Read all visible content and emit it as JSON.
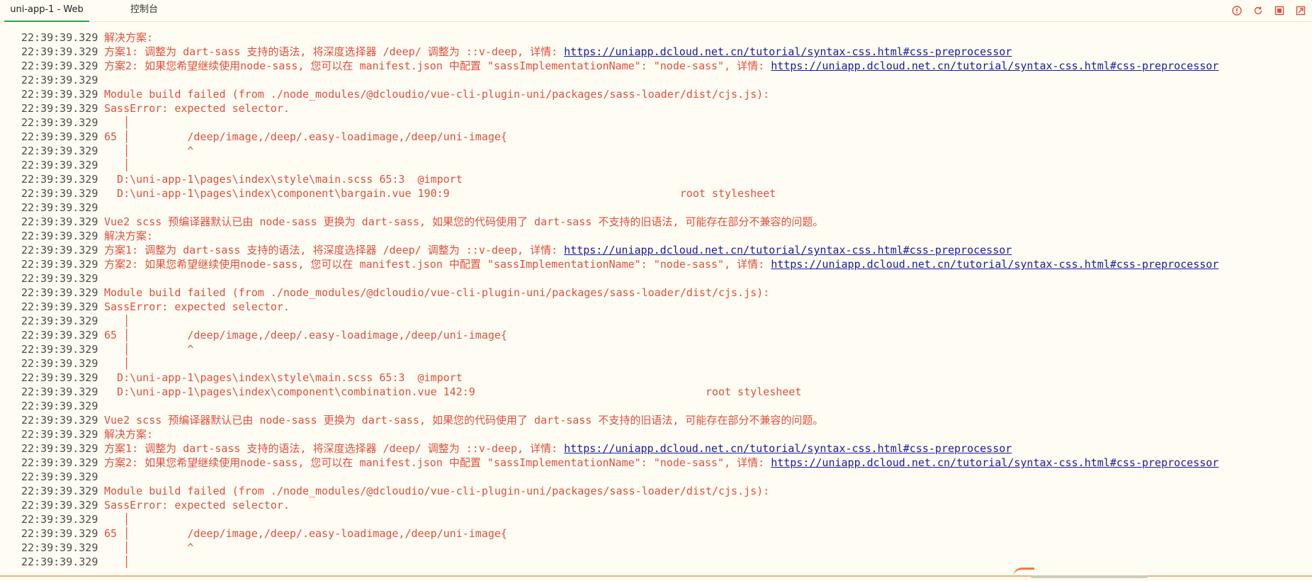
{
  "tabs": [
    {
      "label": "uni-app-1 - Web",
      "active": true
    },
    {
      "label": "控制台",
      "active": false
    }
  ],
  "toolbar_icons": [
    "warning-icon",
    "refresh-icon",
    "stop-icon",
    "clear-icon"
  ],
  "colors": {
    "background": "#fffdf3",
    "error": "#e0503f",
    "link": "#1a1aa6",
    "timestamp": "#4b4b4b",
    "active_tab": "#2ea44f"
  },
  "lines": [
    {
      "ts": "22:39:39.329",
      "text": "解决方案:"
    },
    {
      "ts": "22:39:39.329",
      "text": "方案1: 调整为 dart-sass 支持的语法, 将深度选择器 /deep/ 调整为 ::v-deep, 详情: ",
      "link": "https://uniapp.dcloud.net.cn/tutorial/syntax-css.html#css-preprocessor"
    },
    {
      "ts": "22:39:39.329",
      "text": "方案2: 如果您希望继续使用node-sass, 您可以在 manifest.json 中配置 \"sassImplementationName\": \"node-sass\", 详情: ",
      "link": "https://uniapp.dcloud.net.cn/tutorial/syntax-css.html#css-preprocessor"
    },
    {
      "ts": "22:39:39.329",
      "text": ""
    },
    {
      "ts": "22:39:39.329",
      "text": "Module build failed (from ./node_modules/@dcloudio/vue-cli-plugin-uni/packages/sass-loader/dist/cjs.js):"
    },
    {
      "ts": "22:39:39.329",
      "text": "SassError: expected selector."
    },
    {
      "ts": "22:39:39.329",
      "text": "   │"
    },
    {
      "ts": "22:39:39.329",
      "text": "65 │         /deep/image,/deep/.easy-loadimage,/deep/uni-image{"
    },
    {
      "ts": "22:39:39.329",
      "text": "   │         ^"
    },
    {
      "ts": "22:39:39.329",
      "text": "   │"
    },
    {
      "ts": "22:39:39.329",
      "text": "  D:\\uni-app-1\\pages\\index\\style\\main.scss 65:3  @import"
    },
    {
      "ts": "22:39:39.329",
      "text": "  D:\\uni-app-1\\pages\\index\\component\\bargain.vue 190:9                                    root stylesheet"
    },
    {
      "ts": "22:39:39.329",
      "text": ""
    },
    {
      "ts": "22:39:39.329",
      "text": "Vue2 scss 预编译器默认已由 node-sass 更换为 dart-sass, 如果您的代码使用了 dart-sass 不支持的旧语法, 可能存在部分不兼容的问题。"
    },
    {
      "ts": "22:39:39.329",
      "text": "解决方案:"
    },
    {
      "ts": "22:39:39.329",
      "text": "方案1: 调整为 dart-sass 支持的语法, 将深度选择器 /deep/ 调整为 ::v-deep, 详情: ",
      "link": "https://uniapp.dcloud.net.cn/tutorial/syntax-css.html#css-preprocessor"
    },
    {
      "ts": "22:39:39.329",
      "text": "方案2: 如果您希望继续使用node-sass, 您可以在 manifest.json 中配置 \"sassImplementationName\": \"node-sass\", 详情: ",
      "link": "https://uniapp.dcloud.net.cn/tutorial/syntax-css.html#css-preprocessor"
    },
    {
      "ts": "22:39:39.329",
      "text": ""
    },
    {
      "ts": "22:39:39.329",
      "text": "Module build failed (from ./node_modules/@dcloudio/vue-cli-plugin-uni/packages/sass-loader/dist/cjs.js):"
    },
    {
      "ts": "22:39:39.329",
      "text": "SassError: expected selector."
    },
    {
      "ts": "22:39:39.329",
      "text": "   │"
    },
    {
      "ts": "22:39:39.329",
      "text": "65 │         /deep/image,/deep/.easy-loadimage,/deep/uni-image{"
    },
    {
      "ts": "22:39:39.329",
      "text": "   │         ^"
    },
    {
      "ts": "22:39:39.329",
      "text": "   │"
    },
    {
      "ts": "22:39:39.329",
      "text": "  D:\\uni-app-1\\pages\\index\\style\\main.scss 65:3  @import"
    },
    {
      "ts": "22:39:39.329",
      "text": "  D:\\uni-app-1\\pages\\index\\component\\combination.vue 142:9                                    root stylesheet"
    },
    {
      "ts": "22:39:39.329",
      "text": ""
    },
    {
      "ts": "22:39:39.329",
      "text": "Vue2 scss 预编译器默认已由 node-sass 更换为 dart-sass, 如果您的代码使用了 dart-sass 不支持的旧语法, 可能存在部分不兼容的问题。"
    },
    {
      "ts": "22:39:39.329",
      "text": "解决方案:"
    },
    {
      "ts": "22:39:39.329",
      "text": "方案1: 调整为 dart-sass 支持的语法, 将深度选择器 /deep/ 调整为 ::v-deep, 详情: ",
      "link": "https://uniapp.dcloud.net.cn/tutorial/syntax-css.html#css-preprocessor"
    },
    {
      "ts": "22:39:39.329",
      "text": "方案2: 如果您希望继续使用node-sass, 您可以在 manifest.json 中配置 \"sassImplementationName\": \"node-sass\", 详情: ",
      "link": "https://uniapp.dcloud.net.cn/tutorial/syntax-css.html#css-preprocessor"
    },
    {
      "ts": "22:39:39.329",
      "text": ""
    },
    {
      "ts": "22:39:39.329",
      "text": "Module build failed (from ./node_modules/@dcloudio/vue-cli-plugin-uni/packages/sass-loader/dist/cjs.js):"
    },
    {
      "ts": "22:39:39.329",
      "text": "SassError: expected selector."
    },
    {
      "ts": "22:39:39.329",
      "text": "   │"
    },
    {
      "ts": "22:39:39.329",
      "text": "65 │         /deep/image,/deep/.easy-loadimage,/deep/uni-image{"
    },
    {
      "ts": "22:39:39.329",
      "text": "   │         ^"
    },
    {
      "ts": "22:39:39.329",
      "text": "   │"
    }
  ]
}
